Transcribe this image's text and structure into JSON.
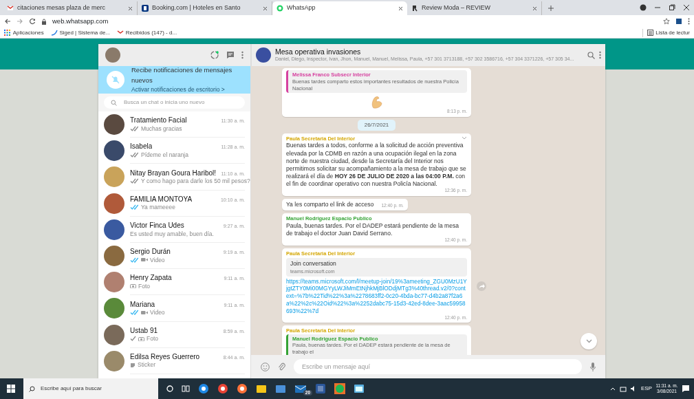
{
  "browser": {
    "tabs": [
      {
        "title": "citaciones mesas plaza de merc",
        "selected": false
      },
      {
        "title": "Booking.com | Hoteles en Santo",
        "selected": false
      },
      {
        "title": "WhatsApp",
        "selected": true
      },
      {
        "title": "Review Moda – REVIEW",
        "selected": false
      }
    ],
    "address": "web.whatsapp.com",
    "bookmarks": [
      {
        "label": "Aplicaciones"
      },
      {
        "label": "Siged | Sistema de..."
      },
      {
        "label": "Recibidos (147) - d..."
      }
    ],
    "reading_list": "Lista de lectur"
  },
  "sidebar": {
    "notification": {
      "title": "Recibe notificaciones de mensajes nuevos",
      "link": "Activar notificaciones de escritorio >"
    },
    "search": {
      "placeholder": "Busca un chat o inicia uno nuevo"
    },
    "chats": [
      {
        "name": "Tratamiento Facial",
        "time": "11:30 a. m.",
        "kind": "text",
        "delivered": true,
        "read": false,
        "preview": "Muchas gracias"
      },
      {
        "name": "Isabela",
        "time": "11:28 a. m.",
        "kind": "text",
        "delivered": true,
        "read": false,
        "preview": "Pídeme el naranja"
      },
      {
        "name": "Nitay Brayan Goura Haribol!",
        "time": "11:10 a. m.",
        "kind": "text",
        "delivered": true,
        "read": false,
        "preview": "Y como hago para darle los 50 mil pesos?"
      },
      {
        "name": "FAMILIA MONTOYA",
        "time": "10:10 a. m.",
        "kind": "text",
        "delivered": true,
        "read": true,
        "preview": "Ya mameeee"
      },
      {
        "name": "Victor Finca Udes",
        "time": "9:27 a. m.",
        "kind": "text",
        "preview": "Es usted muy amable, buen día."
      },
      {
        "name": "Sergio Durán",
        "time": "9:19 a. m.",
        "kind": "video",
        "delivered": true,
        "read": true,
        "preview": "Video"
      },
      {
        "name": "Henry Zapata",
        "time": "9:11 a. m.",
        "kind": "photo",
        "preview": "Foto"
      },
      {
        "name": "Mariana",
        "time": "9:11 a. m.",
        "kind": "video",
        "delivered": true,
        "read": true,
        "preview": "Video"
      },
      {
        "name": "Ustab 91",
        "time": "8:59 a. m.",
        "kind": "photo",
        "delivered": false,
        "read": false,
        "preview": "Foto"
      },
      {
        "name": "Edilsa Reyes Guerrero",
        "time": "8:44 a. m.",
        "kind": "sticker",
        "preview": "Sticker"
      }
    ]
  },
  "chat": {
    "title": "Mesa operativa invasiones",
    "members": "Daniel, Diego, Inspector, Ivan, Jhon, Manuel, Manuel, Melissa, Paula, +57 301 3713188, +57 302 3586716, +57 304 3371226, +57 305 34...",
    "messages": [
      {
        "kind": "emoji",
        "quote": {
          "author": "Melissa Franco Subsecr Interior",
          "color": "#d6409f",
          "text": "Buenas tardes comparto estos importantes resultados de nuestra Policía Nacional"
        },
        "time": "8:13 p. m."
      },
      {
        "kind": "date",
        "text": "26/7/2021"
      },
      {
        "kind": "text",
        "author": "Paula Secretaria Del Interior",
        "color": "#d4a600",
        "menu": true,
        "text": "Buenas tardes a todos, conforme a la solicitud de acción preventiva elevada por la CDMB en razón a una ocupación ilegal en la zona norte de nuestra ciudad, desde la Secretaría del Interior nos permitimos solicitar su acompañamiento a la mesa de trabajo que se realizará el día de **HOY 26 DE JULIO DE 2020 a las 04:00 P.M.** con el fin de coordinar operativo con nuestra Policía Nacional.",
        "time": "12:36 p. m."
      },
      {
        "kind": "text",
        "text": "Ya les comparto el link de acceso",
        "time": "12:40 p. m."
      },
      {
        "kind": "text",
        "author": "Manuel Rodriguez Espacio Publico",
        "color": "#35a335",
        "text": "Paula, buenas tardes. Por el DADEP estará pendiente de la mesa de trabajo el doctor Juan David Serrano.",
        "time": "12:40 p. m."
      },
      {
        "kind": "link",
        "author": "Paula Secretaria Del Interior",
        "color": "#d4a600",
        "preview_title": "Join conversation",
        "preview_site": "teams.microsoft.com",
        "url": "https://teams.microsoft.com/l/meetup-join/19%3ameeting_ZGU0MzU1YjgtZTY0Mi00MGYyLWJiMmEtNjhkMjBlODdjMTg3%40thread.v2/0?context=%7b%22Tid%22%3a%2278683ff2-0c20-4bda-bc77-d4b2a87f2a6a%22%2c%22Oid%22%3a%2252dabc75-15d3-42ed-8dee-3aac59958693%22%7d",
        "time": "12:40 p. m.",
        "forward": true
      },
      {
        "kind": "quote",
        "author": "Paula Secretaria Del Interior",
        "color": "#d4a600",
        "quote": {
          "author": "Manuel Rodriguez Espacio Publico",
          "color": "#35a335",
          "text": "Paula, buenas tardes. Por el DADEP estará pendiente de la mesa de trabajo el"
        }
      }
    ],
    "composer": {
      "placeholder": "Escribe un mensaje aquí"
    }
  },
  "taskbar": {
    "search_placeholder": "Escribe aquí para buscar",
    "badge": "20",
    "language": "ESP",
    "time": "11:31 a. m.",
    "date": "3/08/2021"
  }
}
